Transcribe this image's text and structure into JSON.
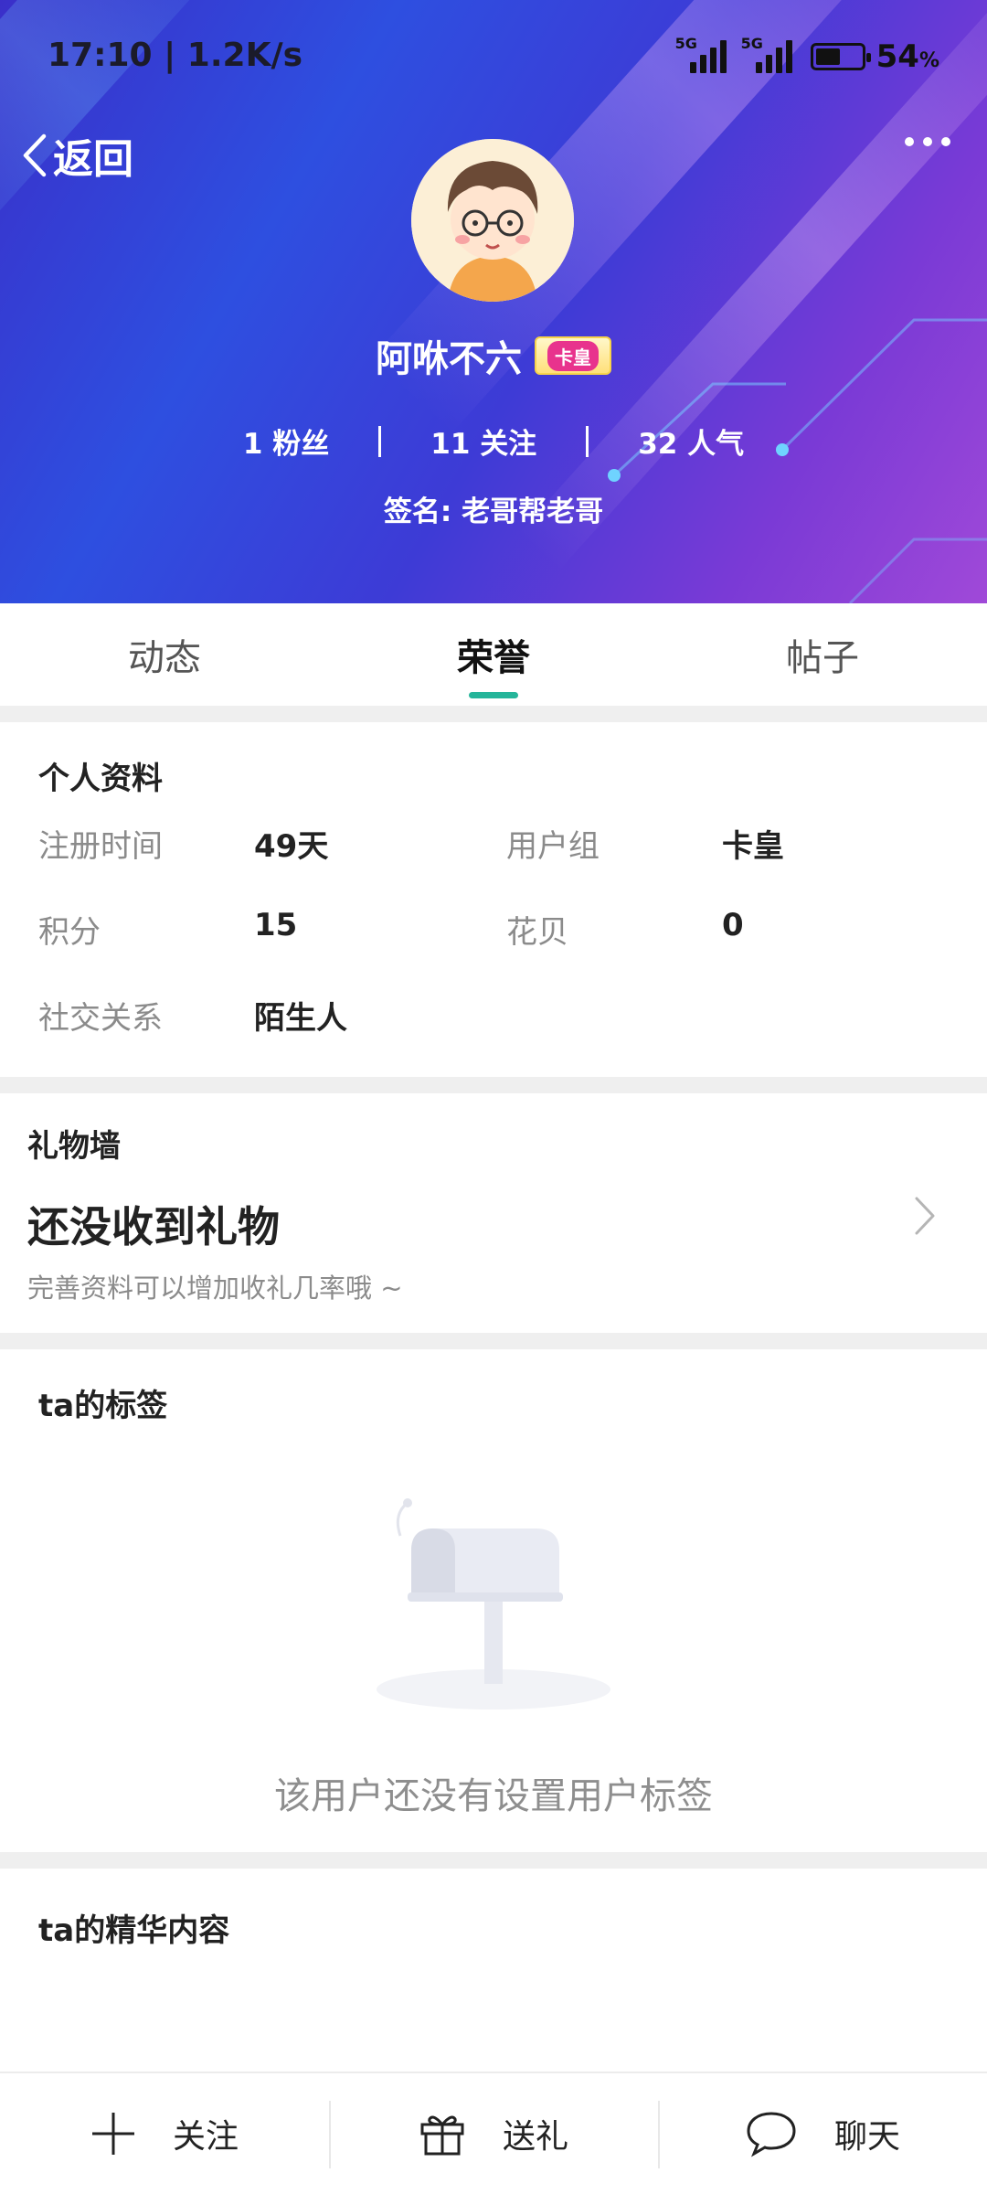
{
  "status_bar": {
    "time_speed": "17:10 | 1.2K/s",
    "network_1": "5G",
    "network_2": "5G",
    "battery_percent": "54",
    "battery_unit": "%",
    "battery_level": 0.54
  },
  "nav": {
    "back_label": "返回"
  },
  "profile": {
    "name": "阿咻不六",
    "badge": "卡皇",
    "stats": [
      {
        "value": "1",
        "label": "粉丝"
      },
      {
        "value": "11",
        "label": "关注"
      },
      {
        "value": "32",
        "label": "人气"
      }
    ],
    "signature": "签名: 老哥帮老哥"
  },
  "tabs": [
    {
      "label": "动态",
      "active": false
    },
    {
      "label": "荣誉",
      "active": true
    },
    {
      "label": "帖子",
      "active": false
    }
  ],
  "personal_info": {
    "title": "个人资料",
    "rows": [
      {
        "label": "注册时间",
        "value": "49天"
      },
      {
        "label": "用户组",
        "value": "卡皇"
      },
      {
        "label": "积分",
        "value": "15"
      },
      {
        "label": "花贝",
        "value": "0"
      },
      {
        "label": "社交关系",
        "value": "陌生人"
      }
    ]
  },
  "gift_wall": {
    "title": "礼物墙",
    "empty_text": "还没收到礼物",
    "hint": "完善资料可以增加收礼几率哦 ~"
  },
  "tags": {
    "title": "ta的标签",
    "empty_text": "该用户还没有设置用户标签"
  },
  "featured": {
    "title": "ta的精华内容"
  },
  "bottom_bar": {
    "follow_label": "关注",
    "gift_label": "送礼",
    "chat_label": "聊天"
  },
  "colors": {
    "accent": "#25b59a",
    "header_start": "#3a2fc9",
    "header_end": "#a049d8"
  }
}
